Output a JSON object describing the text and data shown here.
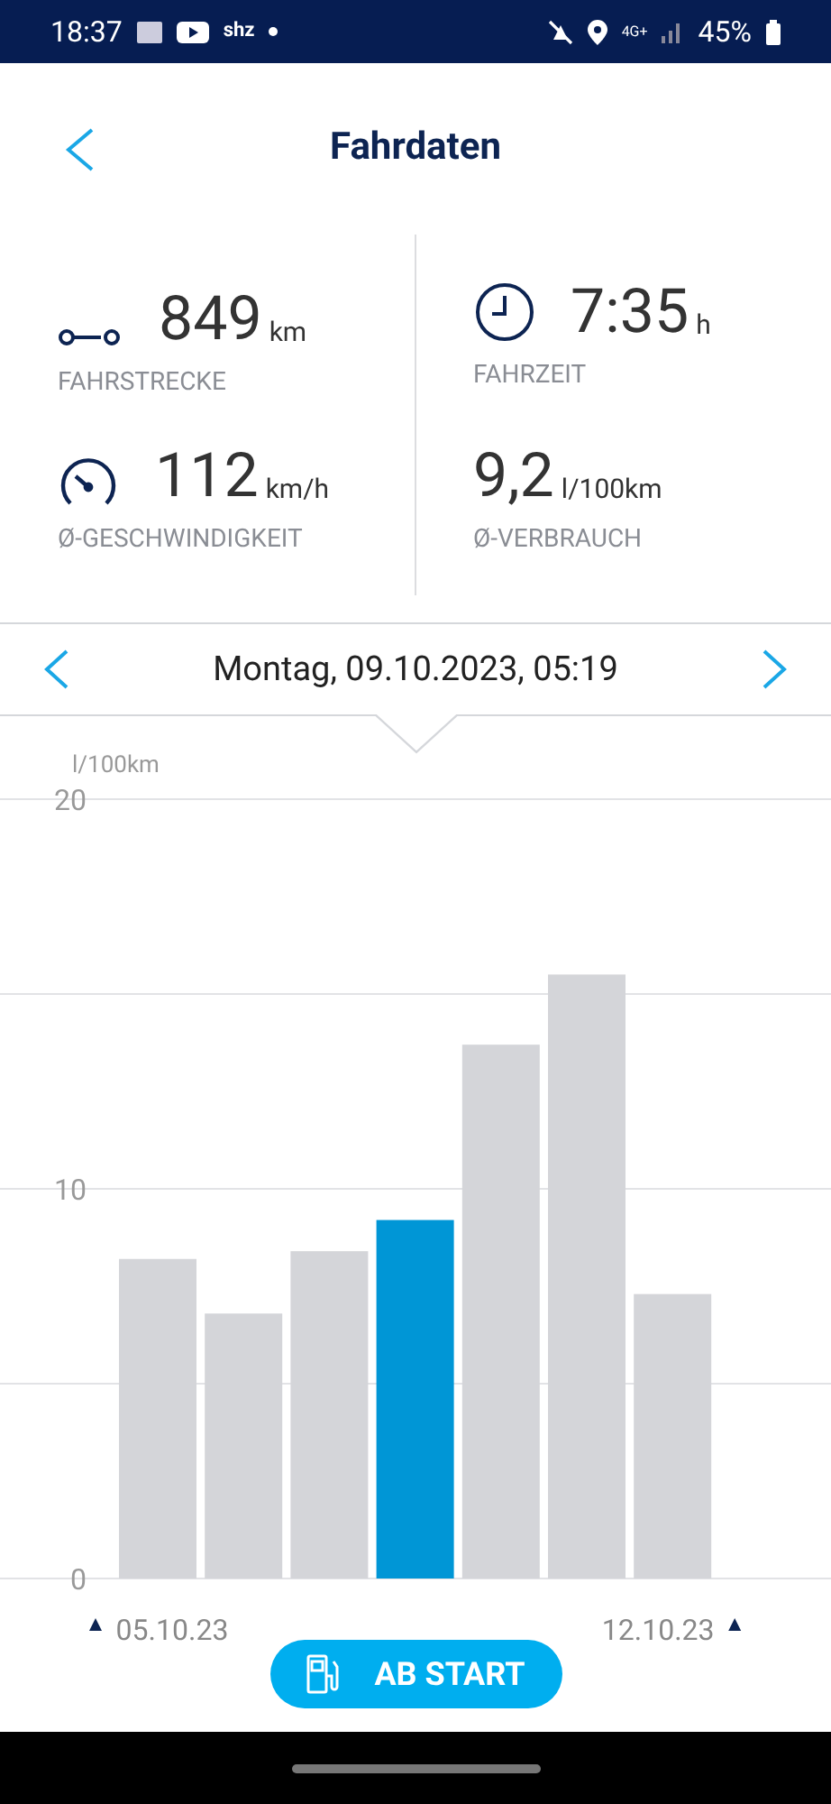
{
  "status_bar": {
    "time": "18:37",
    "app_label": "shz",
    "network": "4G+",
    "battery": "45%"
  },
  "header": {
    "title": "Fahrdaten"
  },
  "stats": [
    {
      "kind": "distance",
      "value": "849",
      "unit": "km",
      "label": "FAHRSTRECKE"
    },
    {
      "kind": "duration",
      "value": "7:35",
      "unit": "h",
      "label": "FAHRZEIT"
    },
    {
      "kind": "speed",
      "value": "112",
      "unit": "km/h",
      "label": "Ø-GESCHWINDIGKEIT"
    },
    {
      "kind": "consumption",
      "value": "9,2",
      "unit": "l/100km",
      "label": "Ø-VERBRAUCH"
    }
  ],
  "date_bar": {
    "date": "Montag, 09.10.2023, 05:19"
  },
  "chart": {
    "chart_data": {
      "type": "bar",
      "ylabel": "l/100km",
      "categories": [
        "05.10.23",
        null,
        null,
        null,
        null,
        null,
        "12.10.23"
      ],
      "ylim": [
        0,
        20
      ],
      "yticks": [
        0,
        10,
        20
      ],
      "series": [
        {
          "color": "#d4d5d9",
          "values": [
            8.2,
            6.8,
            8.4,
            null,
            13.7,
            15.5,
            7.3
          ]
        },
        {
          "color": "#0096d6",
          "values": [
            null,
            null,
            null,
            9.2,
            null,
            null,
            null
          ]
        }
      ]
    }
  },
  "button": {
    "label": "AB START"
  }
}
